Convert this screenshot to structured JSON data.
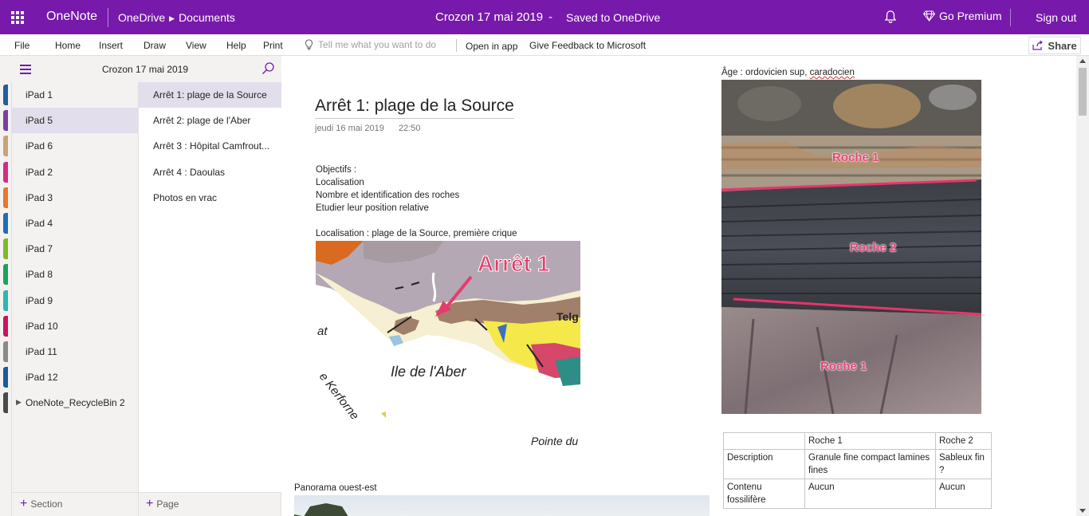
{
  "topbar": {
    "app_name": "OneNote",
    "breadcrumb": [
      "OneDrive",
      "Documents"
    ],
    "doc_title": "Crozon 17 mai 2019",
    "separator": "-",
    "save_status": "Saved to OneDrive",
    "premium_label": "Go Premium",
    "signout_label": "Sign out"
  },
  "ribbon": {
    "tabs": [
      "File",
      "Home",
      "Insert",
      "Draw",
      "View",
      "Help",
      "Print"
    ],
    "tell_me_placeholder": "Tell me what you want to do",
    "open_in_app": "Open in app",
    "feedback": "Give Feedback to Microsoft",
    "share_label": "Share"
  },
  "nav": {
    "notebook_name": "Crozon 17 mai 2019",
    "sections": [
      {
        "label": "iPad 1",
        "color": "#1f5f9e"
      },
      {
        "label": "iPad 5",
        "color": "#7a3fa6"
      },
      {
        "label": "iPad 6",
        "color": "#c8a27e"
      },
      {
        "label": "iPad 2",
        "color": "#d12e86"
      },
      {
        "label": "iPad 3",
        "color": "#e8772e"
      },
      {
        "label": "iPad 4",
        "color": "#1f6fb2"
      },
      {
        "label": "iPad 7",
        "color": "#7fb82b"
      },
      {
        "label": "iPad 8",
        "color": "#1aa35a"
      },
      {
        "label": "iPad 9",
        "color": "#2cb7b0"
      },
      {
        "label": "iPad 10",
        "color": "#c8155b"
      },
      {
        "label": "iPad 11",
        "color": "#8a8a8a"
      },
      {
        "label": "iPad 12",
        "color": "#1b5aa0"
      },
      {
        "label": "OneNote_RecycleBin 2",
        "color": "#4a4a4a"
      }
    ],
    "pages": [
      "Arrêt 1: plage de la Source",
      "Arrêt 2: plage de l'Aber",
      "Arrêt 3 : Hôpital Camfrout...",
      "Arrêt 4 : Daoulas",
      "Photos en vrac"
    ],
    "add_section": "Section",
    "add_page": "Page"
  },
  "page": {
    "title": "Arrêt 1: plage de la Source",
    "date": "jeudi 16 mai 2019",
    "time": "22:50",
    "lines": [
      "Objectifs :",
      "Localisation",
      "Nombre et identification des roches",
      "Etudier leur position relative"
    ],
    "location_line": "Localisation : plage de la Source, première crique",
    "map_labels": {
      "stop": "Arrêt 1",
      "telg": "Telg",
      "at": "at",
      "aber": "Ile de l'Aber",
      "kerforne": "e Kerforne",
      "pointe": "Pointe du"
    },
    "panorama_label": "Panorama ouest-est",
    "age_prefix": "Âge : ordovicien sup, ",
    "age_word": "caradocien",
    "rock_labels": [
      "Roche 1",
      "Roche 2",
      "Roche 1"
    ],
    "table": {
      "header": [
        "",
        "Roche 1",
        "Roche 2"
      ],
      "rows": [
        [
          "Description",
          "Granule fine compact lamines  fines",
          "Sableux fin ?"
        ],
        [
          "Contenu fossilifère",
          "Aucun",
          "Aucun"
        ]
      ]
    }
  }
}
